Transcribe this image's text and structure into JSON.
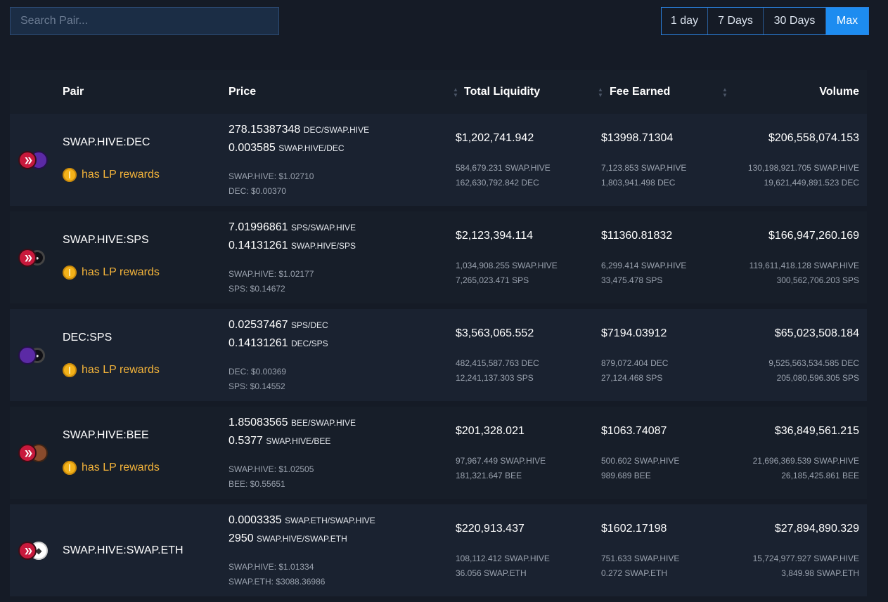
{
  "search": {
    "placeholder": "Search Pair..."
  },
  "ranges": [
    {
      "label": "1 day",
      "active": false
    },
    {
      "label": "7 Days",
      "active": false
    },
    {
      "label": "30 Days",
      "active": false
    },
    {
      "label": "Max",
      "active": true
    }
  ],
  "columns": {
    "pair": "Pair",
    "price": "Price",
    "liquidity": "Total Liquidity",
    "fee": "Fee Earned",
    "volume": "Volume"
  },
  "lp_label": "has LP rewards",
  "colors": {
    "background": "#151b26",
    "accent": "#1d8cf0",
    "lp_text": "#f4b43a",
    "muted": "#9aa2ae"
  },
  "rows": [
    {
      "pair": "SWAP.HIVE:DEC",
      "icons": [
        "hive-icon",
        "dec-icon"
      ],
      "lp": true,
      "price1": "278.15387348",
      "unit1": "DEC/SWAP.HIVE",
      "price2": "0.003585",
      "unit2": "SWAP.HIVE/DEC",
      "usd1": "SWAP.HIVE: $1.02710",
      "usd2": "DEC: $0.00370",
      "liq": "$1,202,741.942",
      "liq1": "584,679.231 SWAP.HIVE",
      "liq2": "162,630,792.842 DEC",
      "fee": "$13998.71304",
      "fee1": "7,123.853 SWAP.HIVE",
      "fee2": "1,803,941.498 DEC",
      "vol": "$206,558,074.153",
      "vol1": "130,198,921.705 SWAP.HIVE",
      "vol2": "19,621,449,891.523 DEC"
    },
    {
      "pair": "SWAP.HIVE:SPS",
      "icons": [
        "hive-icon",
        "sps-icon"
      ],
      "lp": true,
      "price1": "7.01996861",
      "unit1": "SPS/SWAP.HIVE",
      "price2": "0.14131261",
      "unit2": "SWAP.HIVE/SPS",
      "usd1": "SWAP.HIVE: $1.02177",
      "usd2": "SPS: $0.14672",
      "liq": "$2,123,394.114",
      "liq1": "1,034,908.255 SWAP.HIVE",
      "liq2": "7,265,023.471 SPS",
      "fee": "$11360.81832",
      "fee1": "6,299.414 SWAP.HIVE",
      "fee2": "33,475.478 SPS",
      "vol": "$166,947,260.169",
      "vol1": "119,611,418.128 SWAP.HIVE",
      "vol2": "300,562,706.203 SPS"
    },
    {
      "pair": "DEC:SPS",
      "icons": [
        "dec-icon",
        "sps-icon"
      ],
      "lp": true,
      "price1": "0.02537467",
      "unit1": "SPS/DEC",
      "price2": "0.14131261",
      "unit2": "DEC/SPS",
      "usd1": "DEC: $0.00369",
      "usd2": "SPS: $0.14552",
      "liq": "$3,563,065.552",
      "liq1": "482,415,587.763 DEC",
      "liq2": "12,241,137.303 SPS",
      "fee": "$7194.03912",
      "fee1": "879,072.404 DEC",
      "fee2": "27,124.468 SPS",
      "vol": "$65,023,508.184",
      "vol1": "9,525,563,534.585 DEC",
      "vol2": "205,080,596.305 SPS"
    },
    {
      "pair": "SWAP.HIVE:BEE",
      "icons": [
        "hive-icon",
        "bee-icon"
      ],
      "lp": true,
      "price1": "1.85083565",
      "unit1": "BEE/SWAP.HIVE",
      "price2": "0.5377",
      "unit2": "SWAP.HIVE/BEE",
      "usd1": "SWAP.HIVE: $1.02505",
      "usd2": "BEE: $0.55651",
      "liq": "$201,328.021",
      "liq1": "97,967.449 SWAP.HIVE",
      "liq2": "181,321.647 BEE",
      "fee": "$1063.74087",
      "fee1": "500.602 SWAP.HIVE",
      "fee2": "989.689 BEE",
      "vol": "$36,849,561.215",
      "vol1": "21,696,369.539 SWAP.HIVE",
      "vol2": "26,185,425.861 BEE"
    },
    {
      "pair": "SWAP.HIVE:SWAP.ETH",
      "icons": [
        "hive-icon",
        "eth-icon"
      ],
      "lp": false,
      "price1": "0.0003335",
      "unit1": "SWAP.ETH/SWAP.HIVE",
      "price2": "2950",
      "unit2": "SWAP.HIVE/SWAP.ETH",
      "usd1": "SWAP.HIVE: $1.01334",
      "usd2": "SWAP.ETH: $3088.36986",
      "liq": "$220,913.437",
      "liq1": "108,112.412 SWAP.HIVE",
      "liq2": "36.056 SWAP.ETH",
      "fee": "$1602.17198",
      "fee1": "751.633 SWAP.HIVE",
      "fee2": "0.272 SWAP.ETH",
      "vol": "$27,894,890.329",
      "vol1": "15,724,977.927 SWAP.HIVE",
      "vol2": "3,849.98 SWAP.ETH"
    }
  ]
}
